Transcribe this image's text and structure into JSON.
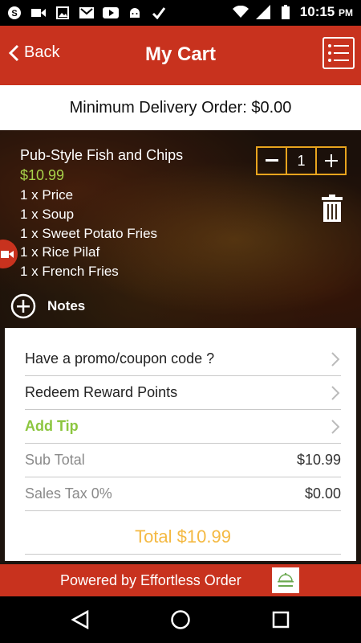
{
  "status_bar": {
    "icons": [
      "skype-icon",
      "video-camera-icon",
      "image-icon",
      "gmail-icon",
      "youtube-icon",
      "android-icon",
      "check-icon"
    ],
    "time": "10:15",
    "ampm": "PM",
    "right_icons": [
      "wifi-icon",
      "signal-icon",
      "battery-icon"
    ]
  },
  "header": {
    "back_label": "Back",
    "title": "My Cart"
  },
  "minimum_order": "Minimum Delivery Order: $0.00",
  "cart_item": {
    "name": "Pub-Style Fish and Chips",
    "price": "$10.99",
    "quantity": "1",
    "options": [
      "1 x Price",
      "1 x Soup",
      "1 x Sweet Potato Fries",
      "1 x Rice Pilaf",
      "1 x French Fries"
    ],
    "notes_label": "Notes"
  },
  "summary": {
    "promo_label": "Have a promo/coupon code ?",
    "redeem_label": "Redeem Reward Points",
    "tip_label": "Add Tip",
    "subtotal_label": "Sub Total",
    "subtotal_value": "$10.99",
    "tax_label": "Sales Tax 0%",
    "tax_value": "$0.00",
    "total_label": "Total $10.99"
  },
  "footer": {
    "powered_by": "Powered by Effortless Order"
  },
  "colors": {
    "brand_red": "#c8321e",
    "price_green": "#a8d34a",
    "tip_green": "#8cc63f",
    "total_yellow": "#f4b942",
    "stepper_orange": "#e8a41e"
  }
}
